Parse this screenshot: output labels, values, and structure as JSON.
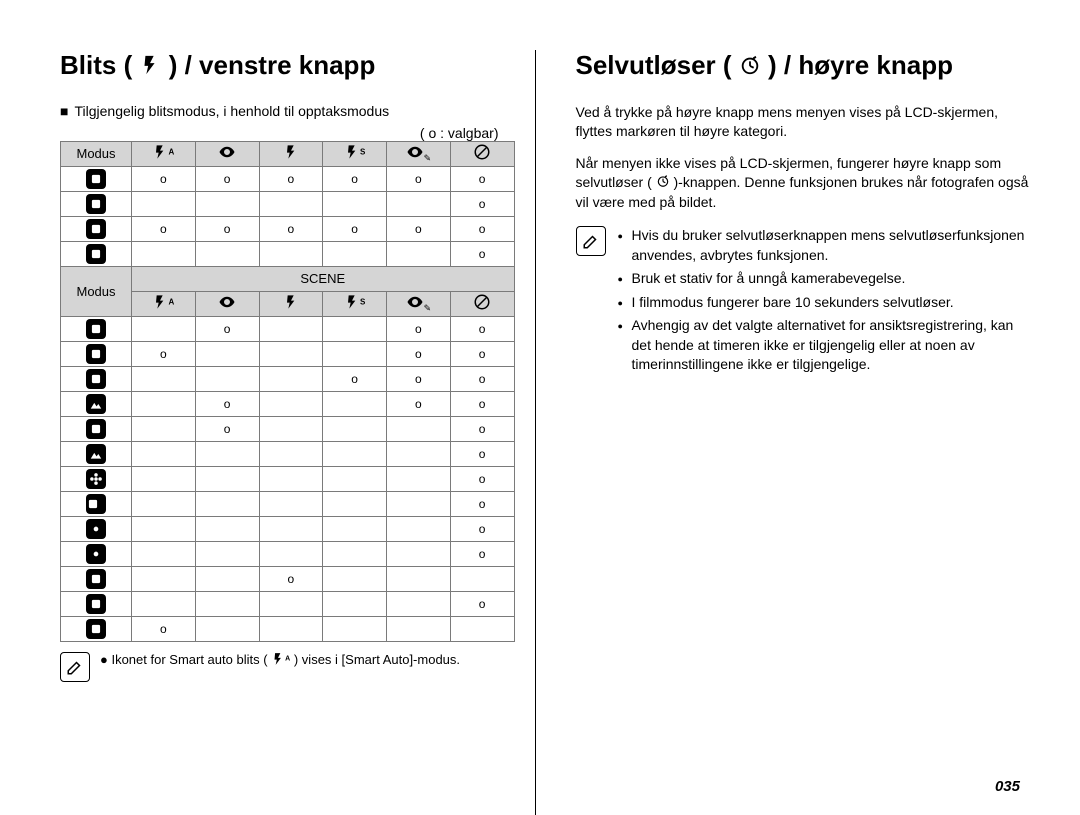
{
  "left": {
    "heading_pre": "Blits (",
    "heading_post": ") / venstre knapp",
    "sub_pre": "Tilgjengelig blitsmodus, i henhold til opptaksmodus",
    "legend": "( o : valgbar)",
    "modus_label": "Modus",
    "scene_label": "SCENE",
    "icons_top": [
      "flash-auto",
      "redeye",
      "flash-fill",
      "flash-slow",
      "redeye-fix",
      "flash-off"
    ],
    "rows_top": [
      {
        "icon": "smart-auto",
        "cells": [
          "o",
          "o",
          "o",
          "o",
          "o",
          "o"
        ]
      },
      {
        "icon": "dis",
        "cells": [
          "",
          "",
          "",
          "",
          "",
          "o"
        ]
      },
      {
        "icon": "program",
        "cells": [
          "o",
          "o",
          "o",
          "o",
          "o",
          "o"
        ]
      },
      {
        "icon": "movie",
        "cells": [
          "",
          "",
          "",
          "",
          "",
          "o"
        ]
      }
    ],
    "rows_scene": [
      {
        "icon": "night",
        "cells": [
          "",
          "o",
          "",
          "",
          "o",
          "o"
        ]
      },
      {
        "icon": "portrait",
        "cells": [
          "o",
          "",
          "",
          "",
          "o",
          "o"
        ]
      },
      {
        "icon": "children",
        "cells": [
          "",
          "",
          "",
          "o",
          "o",
          "o"
        ]
      },
      {
        "icon": "landscape1",
        "cells": [
          "",
          "o",
          "",
          "",
          "o",
          "o"
        ]
      },
      {
        "icon": "closeup1",
        "cells": [
          "",
          "o",
          "",
          "",
          "",
          "o"
        ]
      },
      {
        "icon": "mountain",
        "cells": [
          "",
          "",
          "",
          "",
          "",
          "o"
        ]
      },
      {
        "icon": "flower",
        "cells": [
          "",
          "",
          "",
          "",
          "",
          "o"
        ]
      },
      {
        "icon": "text",
        "cells": [
          "",
          "",
          "",
          "",
          "",
          "o"
        ]
      },
      {
        "icon": "sunset1",
        "cells": [
          "",
          "",
          "",
          "",
          "",
          "o"
        ]
      },
      {
        "icon": "dawn",
        "cells": [
          "",
          "",
          "",
          "",
          "",
          "o"
        ]
      },
      {
        "icon": "backlight",
        "cells": [
          "",
          "",
          "o",
          "",
          "",
          ""
        ]
      },
      {
        "icon": "firework",
        "cells": [
          "",
          "",
          "",
          "",
          "",
          "o"
        ]
      },
      {
        "icon": "beach",
        "cells": [
          "o",
          "",
          "",
          "",
          "",
          ""
        ]
      }
    ],
    "footnote_pre": "Ikonet for Smart auto blits (",
    "footnote_post": ") vises i [Smart Auto]-modus."
  },
  "right": {
    "heading_pre": "Selvutløser (",
    "heading_post": ") / høyre knapp",
    "p1": "Ved å trykke på høyre knapp mens menyen vises på LCD-skjermen, flyttes markøren til høyre kategori.",
    "p2_a": "Når menyen ikke vises på LCD-skjermen, fungerer høyre knapp som selvutløser (",
    "p2_b": ")-knappen. Denne funksjonen brukes når fotografen også vil være med på bildet.",
    "bullets": [
      "Hvis du bruker selvutløserknappen mens selvutløserfunksjonen anvendes, avbrytes funksjonen.",
      "Bruk et stativ for å unngå kamerabevegelse.",
      "I filmmodus fungerer bare 10 sekunders selvutløser.",
      "Avhengig av det valgte alternativet for ansiktsregistrering, kan det hende at timeren ikke er tilgjengelig eller at noen av timerinnstillingene ikke er tilgjengelige."
    ]
  },
  "pagenum": "035"
}
